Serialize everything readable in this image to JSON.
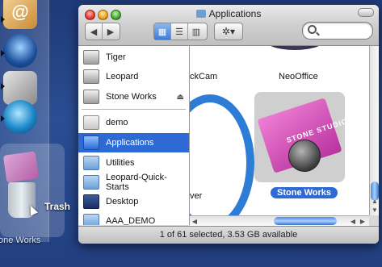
{
  "window": {
    "title": "Applications",
    "status_text": "1 of 61 selected, 3.53 GB available"
  },
  "toolbar": {
    "back_icon": "◀",
    "forward_icon": "▶",
    "view_icons": [
      "▦",
      "☰",
      "▥"
    ],
    "action_icon": "✲▾"
  },
  "sidebar": {
    "items": [
      {
        "label": "Tiger",
        "icon": "disk-icon"
      },
      {
        "label": "Leopard",
        "icon": "disk-icon"
      },
      {
        "label": "Stone Works",
        "icon": "disk-icon",
        "eject": "⏏"
      },
      {
        "label": "demo",
        "icon": "home-icon"
      },
      {
        "label": "Applications",
        "icon": "applications-icon",
        "selected": true
      },
      {
        "label": "Utilities",
        "icon": "folder-icon"
      },
      {
        "label": "Leopard-Quick-Starts",
        "icon": "folder-icon"
      },
      {
        "label": "Desktop",
        "icon": "desktop-icon"
      },
      {
        "label": "AAA_DEMO",
        "icon": "folder-icon"
      }
    ]
  },
  "main": {
    "partial_label_1": "ckCam",
    "partial_label_2": "NeoOffice",
    "partial_label_3": "ver",
    "selected_item": "Stone Works",
    "tile_text": "STONE STUDIO"
  },
  "dock": {
    "trash_label": "Trash",
    "bottom_label": "one Works"
  }
}
